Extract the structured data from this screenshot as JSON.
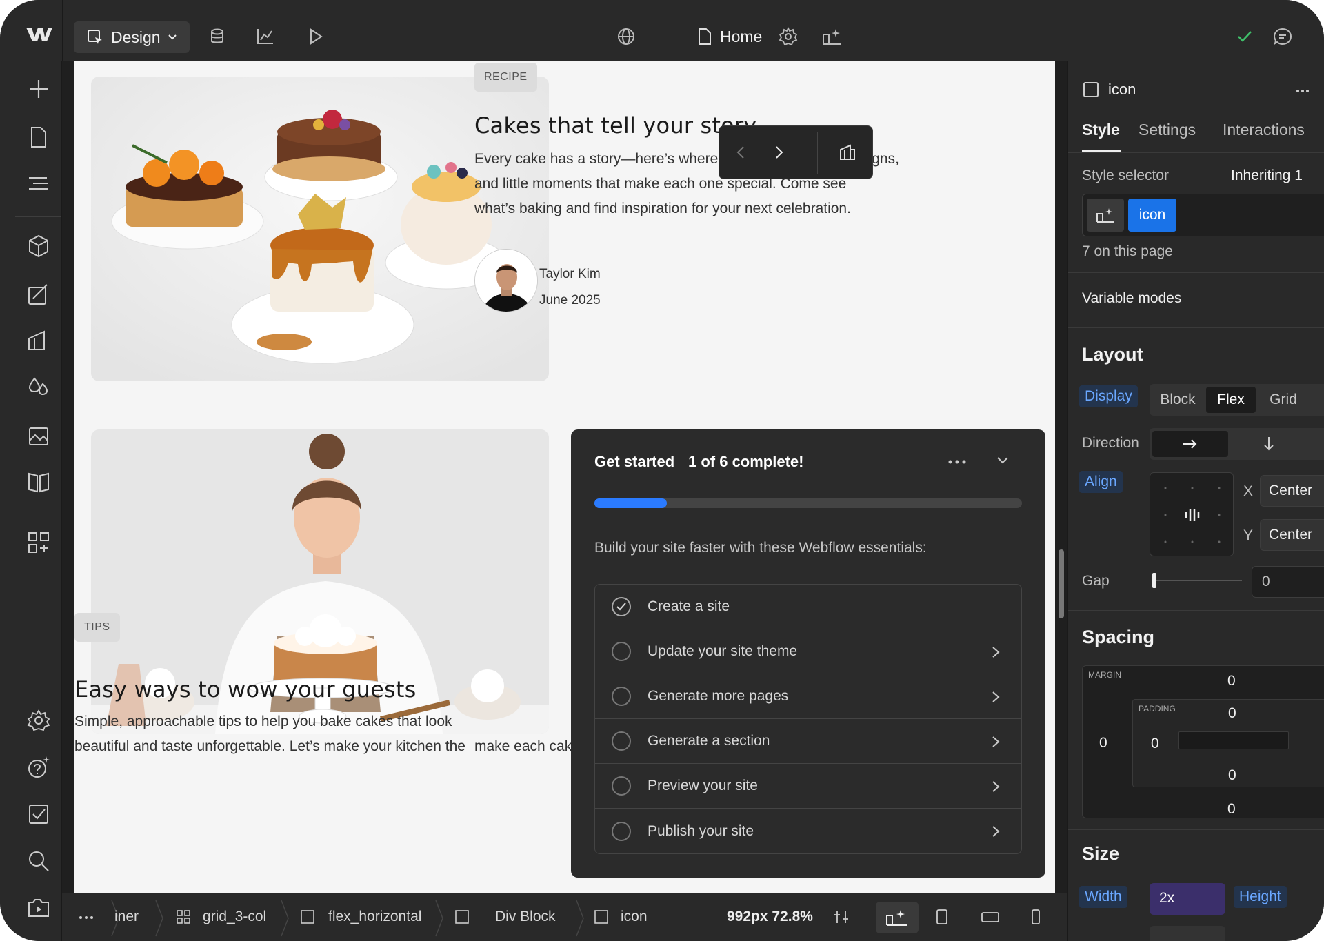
{
  "toolbar": {
    "mode_label": "Design",
    "page_label": "Home"
  },
  "canvas": {
    "post1": {
      "tag": "RECIPE",
      "title": "Cakes that tell your story",
      "body_line1": "Every cake has a story—here’s where I share the flavors, designs,",
      "body_line2": "and little moments that make each one special. Come see",
      "body_line3": "what’s baking and find inspiration for your next celebration.",
      "author": "Taylor Kim",
      "date": "June 2025"
    },
    "post2": {
      "tag": "TIPS",
      "title": "Easy ways to wow your guests",
      "body_line1": "Simple, approachable tips to help you bake cakes that look",
      "body_line2": "beautiful and taste unforgettable. Let’s make your kitchen the"
    },
    "peek_text": "make each cake unique. Join me in celebrating bold flavors and"
  },
  "get_started": {
    "title": "Get started",
    "count": "1 of 6 complete!",
    "progress": 0.17,
    "subtitle": "Build your site faster with these Webflow essentials:",
    "items": [
      {
        "label": "Create a site",
        "done": true
      },
      {
        "label": "Update your site theme",
        "done": false
      },
      {
        "label": "Generate more pages",
        "done": false
      },
      {
        "label": "Generate a section",
        "done": false
      },
      {
        "label": "Preview your site",
        "done": false
      },
      {
        "label": "Publish your site",
        "done": false
      }
    ]
  },
  "panel": {
    "element_name": "icon",
    "tabs": [
      "Style",
      "Settings",
      "Interactions"
    ],
    "style_selector_label": "Style selector",
    "inheriting_label": "Inheriting 1",
    "class_chip": "icon",
    "on_page": "7 on this page",
    "variable_modes": "Variable modes",
    "layout": {
      "heading": "Layout",
      "display_label": "Display",
      "display_options": [
        "Block",
        "Flex",
        "Grid"
      ],
      "display_selected": "Flex",
      "direction_label": "Direction",
      "align_label": "Align",
      "x_label": "X",
      "y_label": "Y",
      "x_value": "Center",
      "y_value": "Center",
      "gap_label": "Gap",
      "gap_value": "0"
    },
    "spacing": {
      "heading": "Spacing",
      "margin_label": "MARGIN",
      "padding_label": "PADDING",
      "margin_top": "0",
      "margin_left": "0",
      "margin_bottom": "0",
      "padding_top": "0",
      "padding_left": "0",
      "padding_bottom": "0"
    },
    "size": {
      "heading": "Size",
      "width_label": "Width",
      "width_value": "2x",
      "height_label": "Height"
    }
  },
  "bottombar": {
    "crumbs": [
      "iner",
      "grid_3-col",
      "flex_horizontal",
      "Div Block",
      "icon"
    ],
    "viewport": "992px 72.8%"
  },
  "colors": {
    "accent_blue": "#2b7bff",
    "chip_blue": "#1a73e8",
    "width_purple": "#3b2f6b"
  }
}
